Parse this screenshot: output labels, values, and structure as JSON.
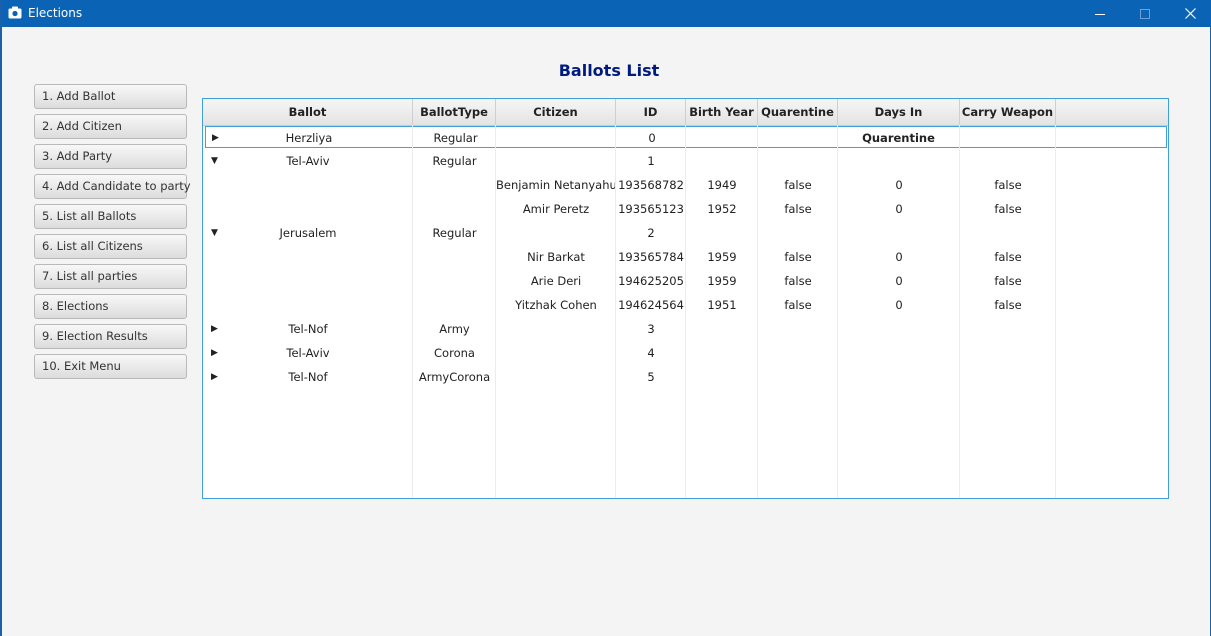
{
  "window": {
    "title": "Elections"
  },
  "heading": "Ballots List",
  "menu": [
    "1. Add Ballot",
    "2. Add Citizen",
    "3. Add Party",
    "4. Add Candidate to party",
    "5. List all Ballots",
    "6. List all Citizens",
    "7. List all parties",
    "8. Elections",
    "9. Election Results",
    "10. Exit Menu"
  ],
  "table": {
    "columns": [
      "Ballot",
      "BallotType",
      "Citizen",
      "ID",
      "Birth Year",
      "Quarentine",
      "Days In Quarentine",
      "Carry Weapon"
    ],
    "rows": [
      {
        "expander": "collapsed",
        "selected": true,
        "cells": [
          "Herzliya",
          "Regular",
          "",
          "0",
          "",
          "",
          "",
          ""
        ]
      },
      {
        "expander": "expanded",
        "cells": [
          "Tel-Aviv",
          "Regular",
          "",
          "1",
          "",
          "",
          "",
          ""
        ]
      },
      {
        "expander": "none",
        "cells": [
          "",
          "",
          "Benjamin Netanyahu",
          "193568782",
          "1949",
          "false",
          "0",
          "false"
        ]
      },
      {
        "expander": "none",
        "cells": [
          "",
          "",
          "Amir Peretz",
          "193565123",
          "1952",
          "false",
          "0",
          "false"
        ]
      },
      {
        "expander": "expanded",
        "cells": [
          "Jerusalem",
          "Regular",
          "",
          "2",
          "",
          "",
          "",
          ""
        ]
      },
      {
        "expander": "none",
        "cells": [
          "",
          "",
          "Nir Barkat",
          "193565784",
          "1959",
          "false",
          "0",
          "false"
        ]
      },
      {
        "expander": "none",
        "cells": [
          "",
          "",
          "Arie Deri",
          "194625205",
          "1959",
          "false",
          "0",
          "false"
        ]
      },
      {
        "expander": "none",
        "cells": [
          "",
          "",
          "Yitzhak Cohen",
          "194624564",
          "1951",
          "false",
          "0",
          "false"
        ]
      },
      {
        "expander": "collapsed",
        "cells": [
          "Tel-Nof",
          "Army",
          "",
          "3",
          "",
          "",
          "",
          ""
        ]
      },
      {
        "expander": "collapsed",
        "cells": [
          "Tel-Aviv",
          "Corona",
          "",
          "4",
          "",
          "",
          "",
          ""
        ]
      },
      {
        "expander": "collapsed",
        "cells": [
          "Tel-Nof",
          "ArmyCorona",
          "",
          "5",
          "",
          "",
          "",
          ""
        ]
      }
    ]
  },
  "colors": {
    "titlebar": "#0a63b5",
    "heading": "#001a80",
    "selection": "#3fa0dc"
  }
}
